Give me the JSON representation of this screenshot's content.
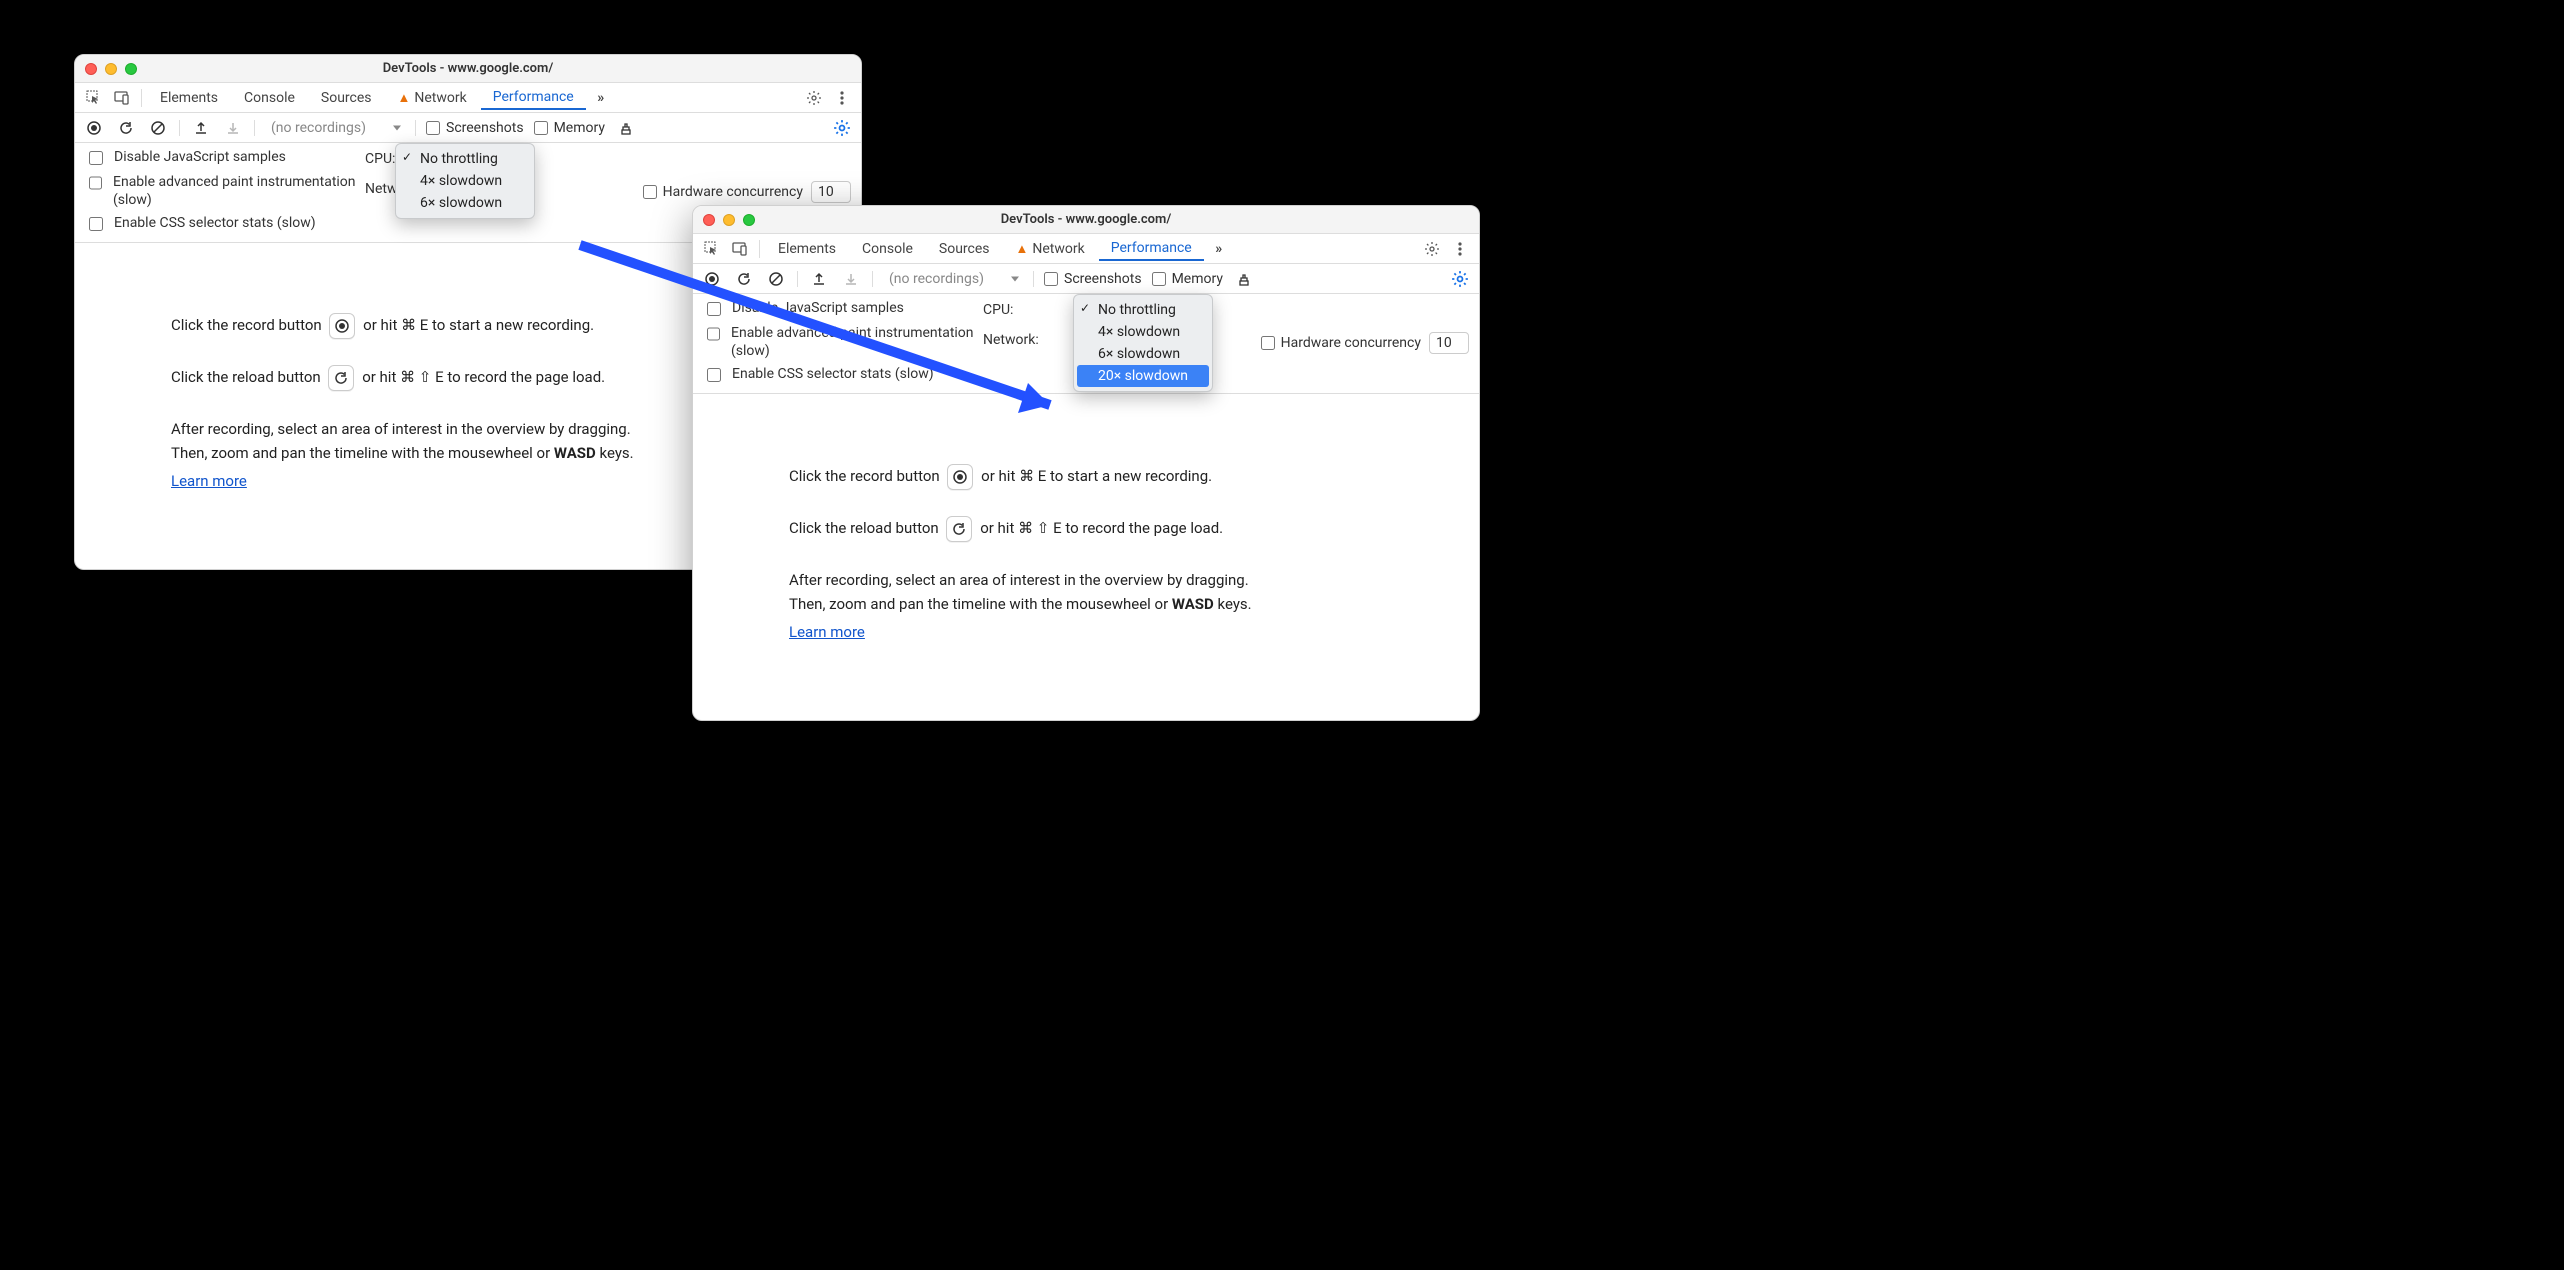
{
  "window": {
    "title": "DevTools - www.google.com/",
    "tabs": [
      "Elements",
      "Console",
      "Sources",
      "Network",
      "Performance"
    ],
    "active_tab": "Performance",
    "recordings_placeholder": "(no recordings)",
    "checkbox_screenshots": "Screenshots",
    "checkbox_memory": "Memory"
  },
  "settings": {
    "disable_js": "Disable JavaScript samples",
    "advanced_paint": "Enable advanced paint instrumentation (slow)",
    "css_selector": "Enable CSS selector stats (slow)",
    "cpu_label": "CPU:",
    "network_label": "Network:",
    "hw_label": "Hardware concurrency",
    "hw_value": "10"
  },
  "dropdown_left": {
    "items": [
      "No throttling",
      "4× slowdown",
      "6× slowdown"
    ],
    "checked": "No throttling"
  },
  "dropdown_right": {
    "items": [
      "No throttling",
      "4× slowdown",
      "6× slowdown",
      "20× slowdown"
    ],
    "checked": "No throttling",
    "selected": "20× slowdown"
  },
  "body": {
    "record_pre": "Click the record button",
    "record_post": "or hit ⌘ E to start a new recording.",
    "reload_pre": "Click the reload button",
    "reload_post": "or hit ⌘ ⇧ E to record the page load.",
    "after1": "After recording, select an area of interest in the overview by dragging.",
    "after2": "Then, zoom and pan the timeline with the mousewheel or ",
    "wasd": "WASD",
    "keys": " keys.",
    "learn": "Learn more"
  }
}
